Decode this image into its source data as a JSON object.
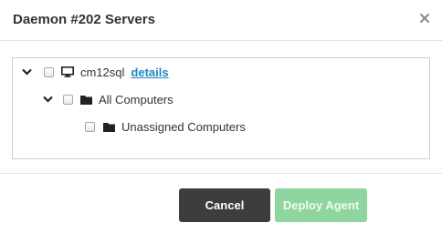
{
  "modal": {
    "title": "Daemon #202 Servers",
    "close_icon": "close-icon"
  },
  "tree": {
    "nodes": [
      {
        "label": "cm12sql",
        "link": "details",
        "icon": "monitor-icon",
        "expanded": true,
        "checked": false
      },
      {
        "label": "All Computers",
        "icon": "folder-icon",
        "expanded": true,
        "checked": false
      },
      {
        "label": "Unassigned Computers",
        "icon": "folder-icon",
        "checked": false
      }
    ]
  },
  "footer": {
    "cancel_label": "Cancel",
    "deploy_label": "Deploy Agent"
  },
  "colors": {
    "cancel_bg": "#3d3d3f",
    "deploy_bg": "#8fd59f",
    "link": "#1e88c8"
  }
}
